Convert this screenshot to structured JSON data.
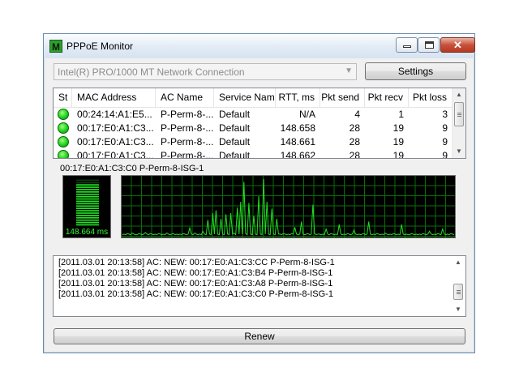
{
  "window": {
    "title": "PPPoE Monitor",
    "app_icon_glyph": "M",
    "accent": "#2f9e2f"
  },
  "adapter": {
    "selected": "Intel(R) PRO/1000 MT Network Connection"
  },
  "buttons": {
    "settings": "Settings",
    "renew": "Renew"
  },
  "table": {
    "columns": [
      "St",
      "MAC Address",
      "AC Name",
      "Service Name",
      "RTT, ms",
      "Pkt send",
      "Pkt recv",
      "Pkt loss"
    ],
    "rows": [
      {
        "status": "green",
        "mac": "00:24:14:A1:E5...",
        "ac": "P-Perm-8-...",
        "service": "Default",
        "rtt": "N/A",
        "send": "4",
        "recv": "1",
        "loss": "3"
      },
      {
        "status": "green",
        "mac": "00:17:E0:A1:C3...",
        "ac": "P-Perm-8-...",
        "service": "Default",
        "rtt": "148.658",
        "send": "28",
        "recv": "19",
        "loss": "9"
      },
      {
        "status": "green",
        "mac": "00:17:E0:A1:C3...",
        "ac": "P-Perm-8-...",
        "service": "Default",
        "rtt": "148.661",
        "send": "28",
        "recv": "19",
        "loss": "9"
      },
      {
        "status": "green",
        "mac": "00:17:E0:A1:C3...",
        "ac": "P-Perm-8-...",
        "service": "Default",
        "rtt": "148.662",
        "send": "28",
        "recv": "19",
        "loss": "9"
      }
    ]
  },
  "graph": {
    "selected_label": "00:17:E0:A1:C3:C0  P-Perm-8-ISG-1",
    "meter_value": "148.664 ms",
    "meter_level": 0.88,
    "line_color": "#22e022",
    "grid_color": "#0a6e0a",
    "samples": [
      2,
      3,
      2,
      4,
      3,
      2,
      5,
      3,
      2,
      2,
      4,
      3,
      2,
      3,
      6,
      3,
      2,
      4,
      3,
      2,
      3,
      2,
      4,
      3,
      2,
      3,
      2,
      5,
      3,
      2,
      3,
      4,
      2,
      3,
      2,
      3,
      2,
      4,
      3,
      2,
      3,
      14,
      3,
      2,
      5,
      3,
      2,
      3,
      2,
      8,
      3,
      2,
      28,
      3,
      2,
      40,
      3,
      45,
      3,
      2,
      30,
      3,
      2,
      38,
      3,
      2,
      40,
      3,
      5,
      2,
      50,
      3,
      60,
      3,
      95,
      4,
      2,
      58,
      3,
      2,
      35,
      3,
      2,
      70,
      3,
      2,
      100,
      3,
      60,
      3,
      2,
      48,
      3,
      2,
      30,
      3,
      3,
      2,
      4,
      3,
      2,
      3,
      2,
      4,
      3,
      15,
      3,
      2,
      3,
      25,
      3,
      2,
      3,
      4,
      2,
      3,
      55,
      4,
      2,
      3,
      3,
      2,
      3,
      2,
      12,
      3,
      2,
      4,
      3,
      2,
      3,
      2,
      20,
      3,
      2,
      3,
      2,
      4,
      3,
      2,
      3,
      10,
      3,
      2,
      3,
      2,
      3,
      4,
      2,
      3,
      25,
      3,
      2,
      3,
      2,
      4,
      3,
      2,
      3,
      2,
      5,
      3,
      2,
      3,
      2,
      4,
      3,
      2,
      3,
      2,
      20,
      3,
      2,
      3,
      2,
      2,
      4,
      3,
      2,
      3,
      2,
      3,
      2,
      4,
      3,
      2,
      3,
      8,
      3,
      2,
      3,
      2,
      4,
      3,
      2,
      12,
      3,
      2,
      3,
      2,
      4,
      3,
      2
    ]
  },
  "log": {
    "lines": [
      "[2011.03.01 20:13:58] AC: NEW:  00:17:E0:A1:C3:CC P-Perm-8-ISG-1",
      "[2011.03.01 20:13:58] AC: NEW:  00:17:E0:A1:C3:B4 P-Perm-8-ISG-1",
      "[2011.03.01 20:13:58] AC: NEW:  00:17:E0:A1:C3:A8 P-Perm-8-ISG-1",
      "[2011.03.01 20:13:58] AC: NEW:  00:17:E0:A1:C3:C0 P-Perm-8-ISG-1"
    ]
  }
}
